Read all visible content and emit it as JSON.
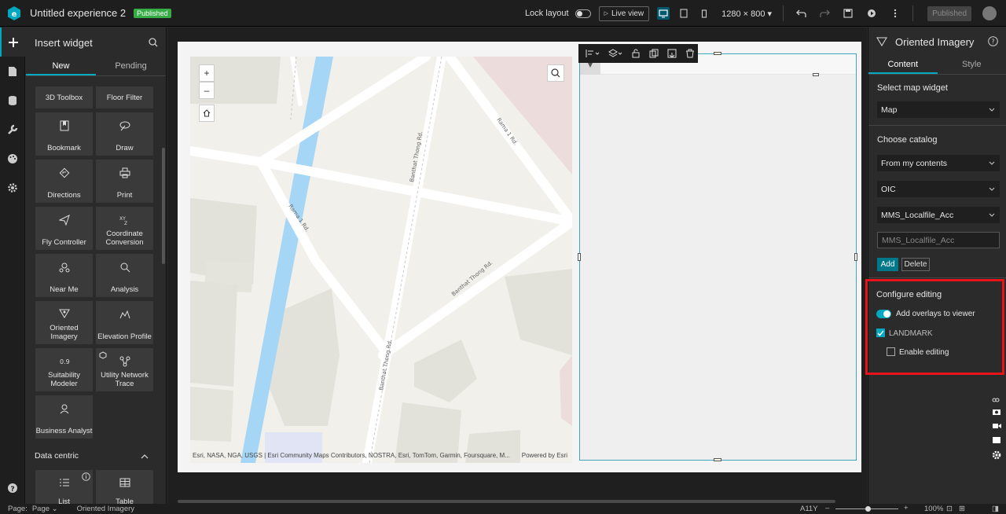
{
  "app": {
    "title": "Untitled experience 2",
    "status_badge": "Published"
  },
  "topbar": {
    "lock_layout": "Lock layout",
    "live_view": "Live view",
    "resolution": "1280 × 800",
    "publish": "Published"
  },
  "insert_panel": {
    "title": "Insert widget",
    "tabs": [
      "New",
      "Pending"
    ],
    "widgets": [
      {
        "label": "3D Toolbox",
        "icon": "toolbox-icon"
      },
      {
        "label": "Floor Filter",
        "icon": "floor-filter-icon"
      },
      {
        "label": "Bookmark",
        "icon": "bookmark-icon"
      },
      {
        "label": "Draw",
        "icon": "draw-icon"
      },
      {
        "label": "Directions",
        "icon": "directions-icon"
      },
      {
        "label": "Print",
        "icon": "print-icon"
      },
      {
        "label": "Fly Controller",
        "icon": "fly-controller-icon"
      },
      {
        "label": "Coordinate Conversion",
        "icon": "coordinate-conversion-icon"
      },
      {
        "label": "Near Me",
        "icon": "near-me-icon"
      },
      {
        "label": "Analysis",
        "icon": "analysis-icon"
      },
      {
        "label": "Oriented Imagery",
        "icon": "oriented-imagery-icon"
      },
      {
        "label": "Elevation Profile",
        "icon": "elevation-profile-icon"
      },
      {
        "label": "Suitability Modeler",
        "icon": "suitability-modeler-icon"
      },
      {
        "label": "Utility Network Trace",
        "icon": "utility-network-trace-icon"
      },
      {
        "label": "Business Analyst",
        "icon": "business-analyst-icon"
      },
      {
        "label": "List",
        "icon": "list-icon"
      },
      {
        "label": "Table",
        "icon": "table-icon"
      }
    ],
    "section_data_centric": "Data centric"
  },
  "map": {
    "zoom_in": "+",
    "zoom_out": "–",
    "road_labels": [
      "Rama 1 Rd.",
      "Banthat Thong Rd.",
      "Rama 1 Rd.",
      "Banthat Thong Rd.",
      "Banthat Thong Rd."
    ],
    "attribution": "Esri, NASA, NGA, USGS | Esri Community Maps Contributors, NOSTRA, Esri, TomTom, Garmin, Foursquare, M...",
    "powered_by": "Powered by Esri"
  },
  "settings_panel": {
    "title": "Oriented Imagery",
    "tabs": [
      "Content",
      "Style"
    ],
    "select_map_widget": "Select map widget",
    "map_value": "Map",
    "choose_catalog": "Choose catalog",
    "catalog_source": "From my contents",
    "catalog_oic": "OIC",
    "catalog_item": "MMS_Localfile_Acc",
    "catalog_input_placeholder": "MMS_Localfile_Acc",
    "add": "Add",
    "delete": "Delete",
    "configure_editing": "Configure editing",
    "add_overlays": "Add overlays to viewer",
    "layer_name": "LANDMARK",
    "enable_editing": "Enable editing"
  },
  "statusbar": {
    "page_label": "Page:",
    "page_value": "Page",
    "selected": "Oriented Imagery",
    "a11y": "A11Y",
    "zoom": "100%"
  },
  "colors": {
    "accent": "#00a9c0",
    "highlight": "#e8131b",
    "published": "#35ac46"
  }
}
